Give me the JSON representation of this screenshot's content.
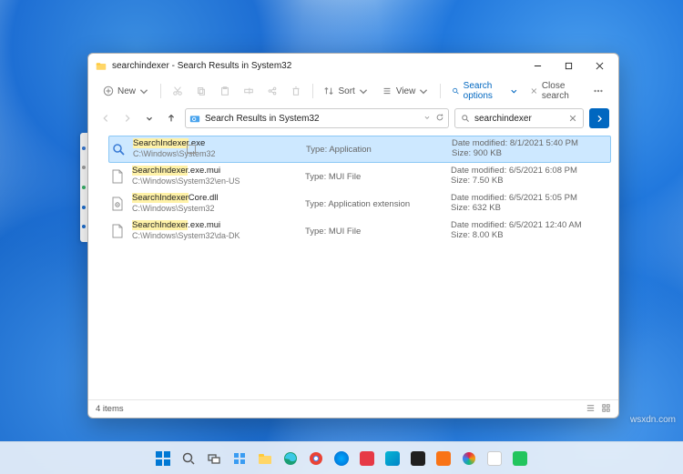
{
  "window": {
    "title": "searchindexer - Search Results in System32"
  },
  "toolbar": {
    "new": "New",
    "sort": "Sort",
    "view": "View",
    "search_options": "Search options",
    "close_search": "Close search"
  },
  "addressbar": {
    "location": "Search Results in System32",
    "query": "searchindexer"
  },
  "labels": {
    "type_prefix": "Type:",
    "date_prefix": "Date modified:",
    "size_prefix": "Size:"
  },
  "results": [
    {
      "highlight": "SearchIndexer",
      "suffix": ".exe",
      "path": "C:\\Windows\\System32",
      "type": "Application",
      "date": "8/1/2021 5:40 PM",
      "size": "900 KB",
      "icon": "app",
      "selected": true
    },
    {
      "highlight": "SearchIndexer",
      "suffix": ".exe.mui",
      "path": "C:\\Windows\\System32\\en-US",
      "type": "MUI File",
      "date": "6/5/2021 6:08 PM",
      "size": "7.50 KB",
      "icon": "file",
      "selected": false
    },
    {
      "highlight": "SearchIndexer",
      "suffix": "Core.dll",
      "path": "C:\\Windows\\System32",
      "type": "Application extension",
      "date": "6/5/2021 5:05 PM",
      "size": "632 KB",
      "icon": "dll",
      "selected": false
    },
    {
      "highlight": "SearchIndexer",
      "suffix": ".exe.mui",
      "path": "C:\\Windows\\System32\\da-DK",
      "type": "MUI File",
      "date": "6/5/2021 12:40 AM",
      "size": "8.00 KB",
      "icon": "file",
      "selected": false
    }
  ],
  "statusbar": {
    "count": "4 items"
  },
  "watermark": "wsxdn.com"
}
